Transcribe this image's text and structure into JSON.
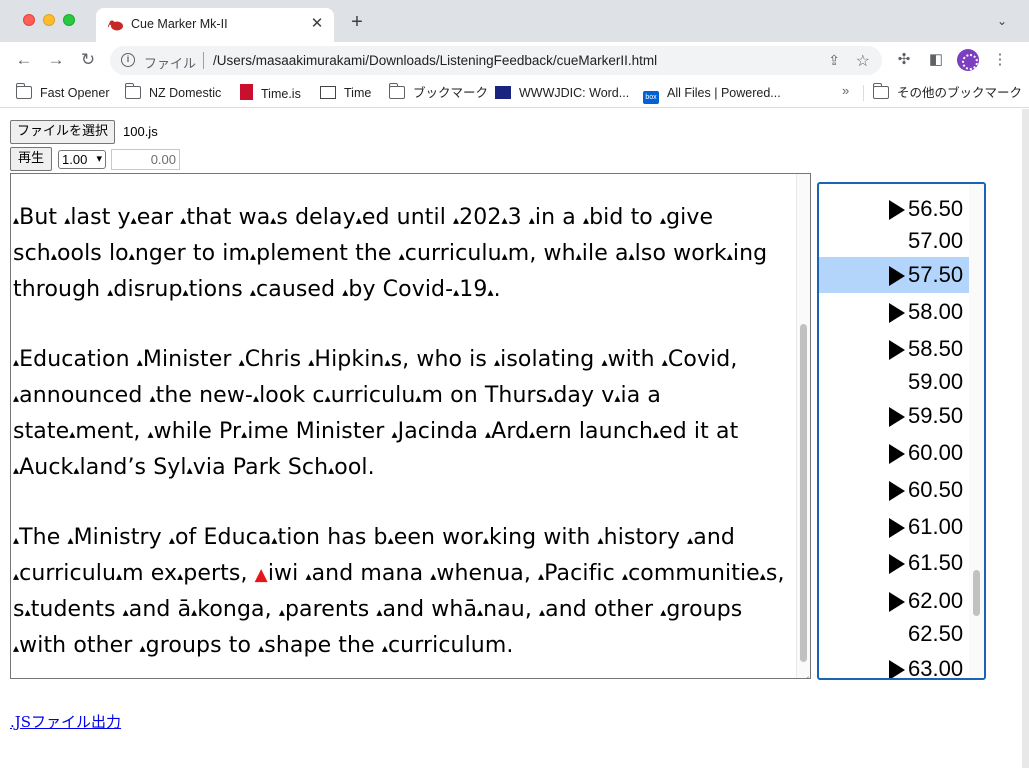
{
  "browser": {
    "tab_title": "Cue Marker Mk-II",
    "tab_close": "✕",
    "new_tab": "+",
    "omnibox_scheme": "ファイル",
    "url": "/Users/masaakimurakami/Downloads/ListeningFeedback/cueMarkerII.html",
    "bookmarks": [
      {
        "label": "Fast Opener",
        "icon": "folder-icon"
      },
      {
        "label": "NZ Domestic",
        "icon": "folder-icon"
      },
      {
        "label": "Time.is",
        "icon": "timeis-icon"
      },
      {
        "label": "Time",
        "icon": "time-icon"
      },
      {
        "label": "ブックマーク",
        "icon": "folder-icon"
      },
      {
        "label": "WWWJDIC: Word...",
        "icon": "wwwjdic-icon"
      },
      {
        "label": "All Files | Powered...",
        "icon": "box-icon"
      },
      {
        "label": "その他のブックマーク",
        "icon": "folder-icon"
      }
    ],
    "bookmarks_more": "»"
  },
  "controls": {
    "file_button": "ファイルを選択",
    "file_name": "100.js",
    "play_button": "再生",
    "speed": "1.00",
    "time_value": "0.00"
  },
  "transcript": {
    "paragraphs": [
      "▴But ▴last y▴ear ▴that wa▴s delay▴ed until ▴202▴3 ▴in a ▴bid to ▴give sch▴ools lo▴nger to im▴plement the ▴curriculu▴m, wh▴ile a▴lso work▴ing through ▴disrup▴tions ▴caused ▴by Covid-▴19▴.",
      "▴Education ▴Minister ▴Chris ▴Hipkin▴s, who is ▴isolating ▴with ▴Covid, ▴announced ▴the new-▴look c▴urriculu▴m on Thurs▴day v▴ia a state▴ment, ▴while Pr▴ime Minister ▴Jacinda ▴Ard▴ern launch▴ed it at ▴Auck▴land’s Syl▴via Park Sch▴ool.",
      "▴The ▴Ministry ▴of Educa▴tion has b▴een wor▴king with ▴history ▴and ▴curriculu▴m ex▴perts, ▲iwi ▴and mana ▴whenua, ▴Pacific ▴communitie▴s, s▴tudents ▴and ā▴konga, ▴parents ▴and whā▴nau, ▴and other ▴groups ▴with other ▴groups to ▴shape the ▴curriculum."
    ],
    "marker_color": "#000000",
    "active_marker_color": "#e8141b"
  },
  "cues": [
    {
      "value": "56.50",
      "marked": true,
      "selected": false
    },
    {
      "value": "57.00",
      "marked": false,
      "selected": false
    },
    {
      "value": "57.50",
      "marked": true,
      "selected": true
    },
    {
      "value": "58.00",
      "marked": true,
      "selected": false
    },
    {
      "value": "58.50",
      "marked": true,
      "selected": false
    },
    {
      "value": "59.00",
      "marked": false,
      "selected": false
    },
    {
      "value": "59.50",
      "marked": true,
      "selected": false
    },
    {
      "value": "60.00",
      "marked": true,
      "selected": false
    },
    {
      "value": "60.50",
      "marked": true,
      "selected": false
    },
    {
      "value": "61.00",
      "marked": true,
      "selected": false
    },
    {
      "value": "61.50",
      "marked": true,
      "selected": false
    },
    {
      "value": "62.00",
      "marked": true,
      "selected": false
    },
    {
      "value": "62.50",
      "marked": false,
      "selected": false
    },
    {
      "value": "63.00",
      "marked": true,
      "selected": false
    }
  ],
  "export_link": ".JSファイル出力",
  "colors": {
    "cue_border": "#1a64b3",
    "cue_selected": "#b3d5fb",
    "link": "#0000ee"
  }
}
